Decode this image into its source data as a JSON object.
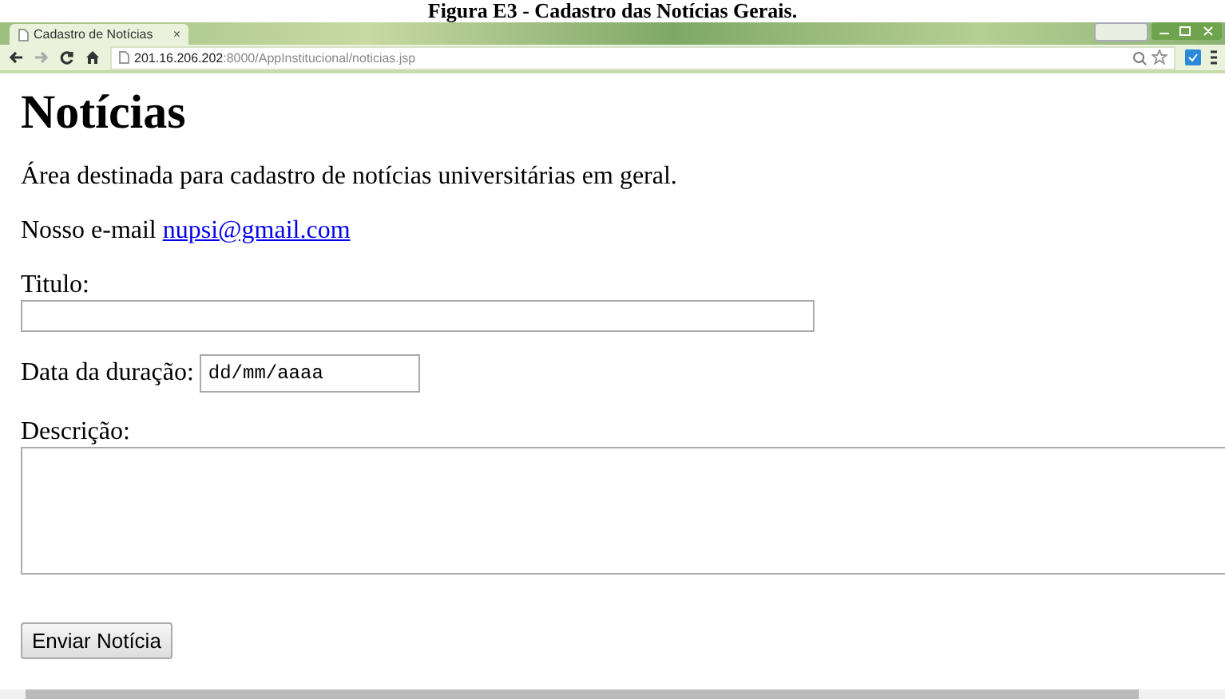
{
  "caption": "Figura E3 - Cadastro das Notícias Gerais.",
  "browser": {
    "tab": {
      "title": "Cadastro de Notícias",
      "close": "×"
    },
    "address": {
      "host": "201.16.206.202",
      "rest": ":8000/AppInstitucional/noticias.jsp"
    }
  },
  "page": {
    "heading": "Notícias",
    "intro": "Área destinada para cadastro de notícias universitárias em geral.",
    "email_label": "Nosso e-mail",
    "email_link": "nupsi@gmail.com",
    "fields": [
      {
        "kind": "text",
        "label": "Titulo:"
      },
      {
        "kind": "date",
        "label": "Data da duração:",
        "placeholder": "dd/mm/aaaa"
      },
      {
        "kind": "textarea",
        "label": "Descrição:"
      }
    ],
    "submit": "Enviar Notícia"
  }
}
